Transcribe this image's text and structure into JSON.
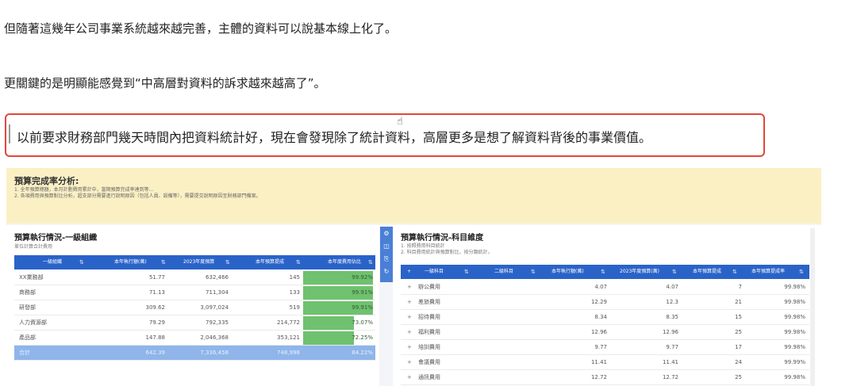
{
  "article": {
    "para1": "但隨著這幾年公司事業系統越來越完善，主體的資料可以說基本線上化了。",
    "para2": "更關鍵的是明顯能感覺到“中高層對資料的訴求越來越高了”。",
    "quote": "以前要求財務部門幾天時間內把資料統計好，現在會發現除了統計資料，高層更多是想了解資料背後的事業價值。"
  },
  "dashboard": {
    "banner": {
      "title": "預算完成率分析:",
      "lines": [
        "1. 全年預算總額，本月計劃費用累計中，當期預算完成率達到等...",
        "2. 各項費用與預算對比分析，超支部分需要進行說明原因（包括人員、設備等），需要提交說明原因至財務部門備案。"
      ]
    },
    "left": {
      "title": "預算執行情況-一級組織",
      "subtitle": "單位計算合計費用",
      "columns": [
        "一級組織",
        "本年執行額(萬)",
        "2023年度預算",
        "本年預算提成",
        "本年度費用佔比"
      ],
      "rows": [
        {
          "org": "XX業務部",
          "a": "51.77",
          "b": "632,466",
          "c": "145",
          "d": "99.92%",
          "pct": 1.0
        },
        {
          "org": "商務部",
          "a": "71.13",
          "b": "711,304",
          "c": "133",
          "d": "99.91%",
          "pct": 1.0
        },
        {
          "org": "研發部",
          "a": "309.62",
          "b": "3,097,024",
          "c": "519",
          "d": "99.91%",
          "pct": 1.0
        },
        {
          "org": "人力資源部",
          "a": "79.29",
          "b": "792,335",
          "c": "214,772",
          "d": "73.07%",
          "pct": 0.73
        },
        {
          "org": "產品部",
          "a": "147.88",
          "b": "2,046,368",
          "c": "353,121",
          "d": "72.25%",
          "pct": 0.7225
        }
      ],
      "total": {
        "org": "合計",
        "a": "642.39",
        "b": "7,336,458",
        "c": "748,998",
        "d": "84.22%"
      }
    },
    "right": {
      "title": "預算執行情況-科目維度",
      "subtitle_lines": [
        "1. 按照費用科目統計",
        "2. 科目費用統計與預算對比，按分類統計。"
      ],
      "columns": [
        "一級科目",
        "二級科目",
        "本年執行額(萬)",
        "2023年度預算(萬)",
        "本年預算提成",
        "本年預算提成率"
      ],
      "rows": [
        {
          "name": "辦公費用",
          "a": "4.07",
          "b": "4.07",
          "c": "7",
          "d": "99.98%"
        },
        {
          "name": "差旅費用",
          "a": "12.29",
          "b": "12.3",
          "c": "21",
          "d": "99.98%"
        },
        {
          "name": "招待費用",
          "a": "8.34",
          "b": "8.35",
          "c": "15",
          "d": "99.98%"
        },
        {
          "name": "福利費用",
          "a": "12.96",
          "b": "12.96",
          "c": "25",
          "d": "99.98%"
        },
        {
          "name": "培訓費用",
          "a": "9.77",
          "b": "9.77",
          "c": "17",
          "d": "99.98%"
        },
        {
          "name": "會議費用",
          "a": "11.41",
          "b": "11.41",
          "c": "24",
          "d": "99.99%"
        },
        {
          "name": "通訊費用",
          "a": "12.72",
          "b": "12.72",
          "c": "25",
          "d": "99.98%"
        }
      ]
    }
  },
  "colors": {
    "accent": "#2a63c8",
    "highlight": "#e2473a",
    "bar": "#6fc16f",
    "banner": "#faf0c4"
  }
}
